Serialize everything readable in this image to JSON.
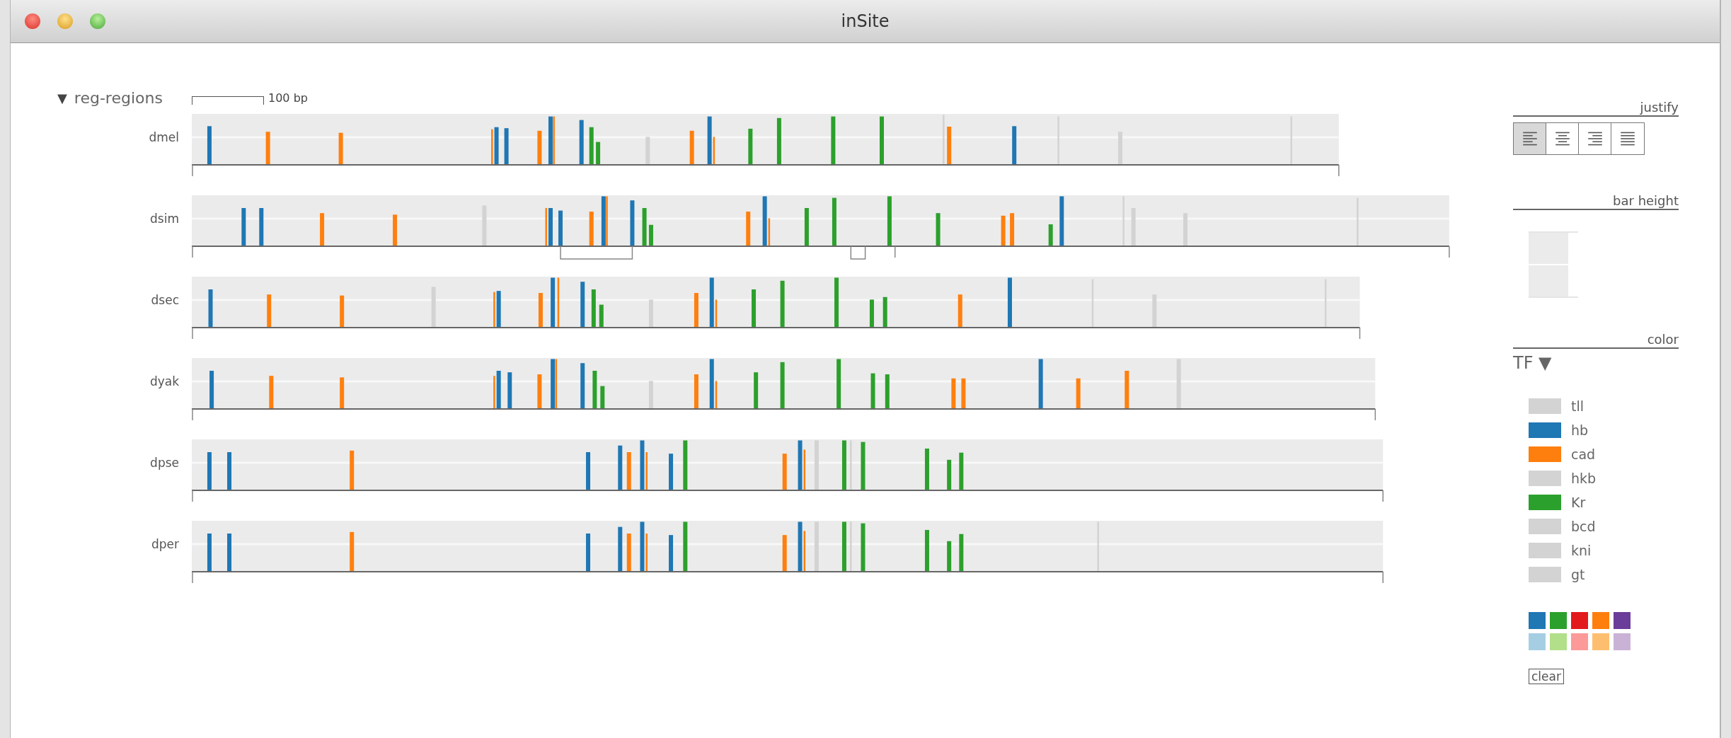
{
  "window": {
    "title": "inSite"
  },
  "section": {
    "toggle": "▼",
    "label": "reg-regions",
    "scale_label": "100 bp"
  },
  "tracks": [
    {
      "name": "dmel"
    },
    {
      "name": "dsim"
    },
    {
      "name": "dsec"
    },
    {
      "name": "dyak"
    },
    {
      "name": "dpse"
    },
    {
      "name": "dper"
    }
  ],
  "justify": {
    "label": "justify",
    "options": [
      {
        "kind": "left",
        "selected": true
      },
      {
        "kind": "center",
        "selected": false
      },
      {
        "kind": "right",
        "selected": false
      },
      {
        "kind": "full",
        "selected": false
      }
    ]
  },
  "bar_height": {
    "label": "bar height"
  },
  "color": {
    "label": "color",
    "dropdown": "TF ▼"
  },
  "legend": [
    {
      "label": "tll",
      "color": "#d3d3d3"
    },
    {
      "label": "hb",
      "color": "#1f77b4"
    },
    {
      "label": "cad",
      "color": "#ff7f0e"
    },
    {
      "label": "hkb",
      "color": "#d3d3d3"
    },
    {
      "label": "Kr",
      "color": "#2ca02c"
    },
    {
      "label": "bcd",
      "color": "#d3d3d3"
    },
    {
      "label": "kni",
      "color": "#d3d3d3"
    },
    {
      "label": "gt",
      "color": "#d3d3d3"
    }
  ],
  "palette": [
    {
      "color": "#1f77b4"
    },
    {
      "color": "#2ca02c"
    },
    {
      "color": "#e31a1c"
    },
    {
      "color": "#ff7f0e"
    },
    {
      "color": "#6a3d9a"
    },
    {
      "color": "#a6cee3"
    },
    {
      "color": "#b2df8a"
    },
    {
      "color": "#fb9a99"
    },
    {
      "color": "#fdbf6f"
    },
    {
      "color": "#cab2d6"
    }
  ],
  "clear_button": "clear"
}
